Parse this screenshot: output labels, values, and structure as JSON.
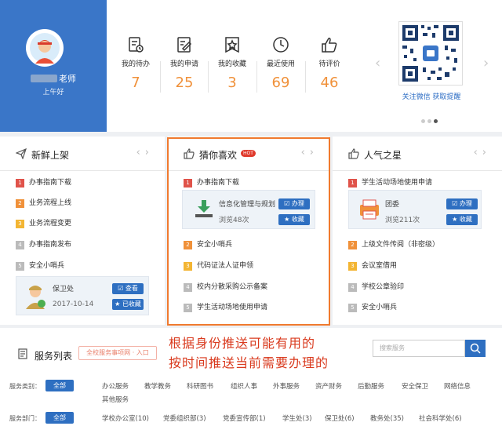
{
  "profile": {
    "name_suffix": "老师",
    "greeting": "上午好"
  },
  "stats": [
    {
      "label": "我的待办",
      "value": "7"
    },
    {
      "label": "我的申请",
      "value": "25"
    },
    {
      "label": "我的收藏",
      "value": "3"
    },
    {
      "label": "最近使用",
      "value": "69"
    },
    {
      "label": "待评价",
      "value": "46"
    }
  ],
  "qr": {
    "caption": "关注微信 获取提醒"
  },
  "panels": {
    "new": {
      "title": "新鲜上架",
      "items": [
        "办事指南下载",
        "业务流程上线",
        "业务流程变更",
        "办事指南发布",
        "安全小哨兵"
      ],
      "ranks": [
        "1",
        "2",
        "3",
        "4",
        "5"
      ],
      "card": {
        "name": "保卫处",
        "date": "2017-10-14",
        "btn1": "查看",
        "btn2": "已收藏"
      }
    },
    "guess": {
      "title": "猜你喜欢",
      "hot": "HOT",
      "items": [
        "办事指南下载",
        "安全小哨兵",
        "代码证法人证申领",
        "校内分散采购公示备案",
        "学生活动场地使用申请"
      ],
      "ranks": [
        "1",
        "2",
        "3",
        "4",
        "5"
      ],
      "card": {
        "name": "信息化管理与规划",
        "views": "浏览48次",
        "btn1": "办理",
        "btn2": "收藏"
      }
    },
    "popular": {
      "title": "人气之星",
      "items": [
        "学生活动场地使用申请",
        "上级文件传阅（非密级）",
        "会议室借用",
        "学校公章验印",
        "安全小哨兵"
      ],
      "ranks": [
        "1",
        "2",
        "3",
        "4",
        "5"
      ],
      "card": {
        "name": "团委",
        "views": "浏览211次",
        "btn1": "办理",
        "btn2": "收藏"
      }
    }
  },
  "service_list": {
    "title": "服务列表",
    "entry": "全校服务事项网 · 入口",
    "search_placeholder": "搜索服务",
    "category_label": "服务类别：",
    "dept_label": "服务部门：",
    "all": "全部",
    "categories": [
      "办公服务",
      "教学教务",
      "科研图书",
      "组织人事",
      "外事服务",
      "资产财务",
      "后勤服务",
      "安全保卫",
      "网络信息",
      "其他服务"
    ],
    "departments": [
      "学校办公室(10)",
      "党委组织部(3)",
      "党委宣传部(1)",
      "学生处(3)",
      "保卫处(6)",
      "教务处(35)",
      "社会科学处(6)"
    ]
  },
  "annotation": {
    "line1": "根据身份推送可能有用的",
    "line2": "按时间推送当前需要办理的"
  },
  "colors": {
    "accent": "#2e6fc1",
    "stat_number": "#f0913a",
    "annotation": "#d93a1e",
    "highlight_border": "#f07a2e"
  }
}
